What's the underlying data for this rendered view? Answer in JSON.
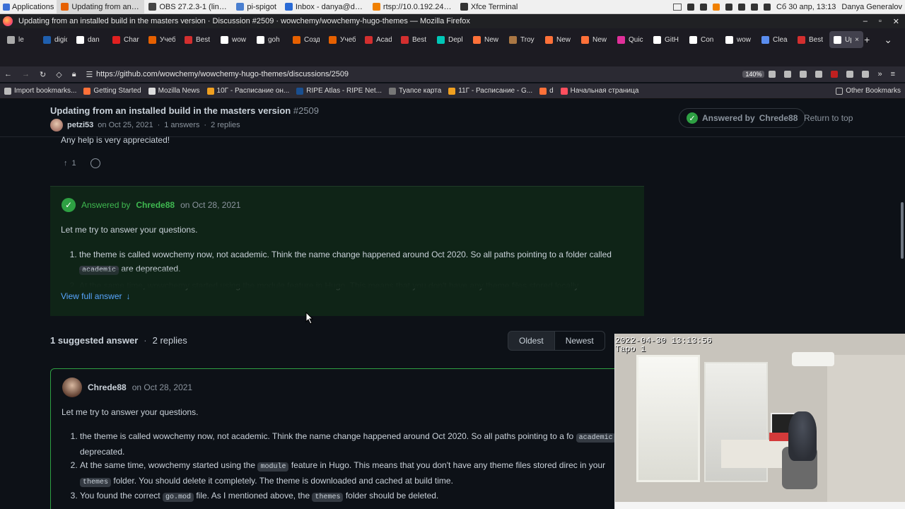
{
  "xfce": {
    "applications_label": "Applications",
    "tasks": [
      {
        "label": "Updating from an in...",
        "color": "#e66000"
      },
      {
        "label": "OBS 27.2.3-1 (linux) -...",
        "color": "#444444"
      },
      {
        "label": "pi-spigot",
        "color": "#4a7fd0"
      },
      {
        "label": "Inbox - danya@dany...",
        "color": "#2a6bd6"
      },
      {
        "label": "rtsp://10.0.192.242/st...",
        "color": "#f08000"
      },
      {
        "label": "Xfce Terminal",
        "color": "#333333"
      }
    ],
    "clock": "Сб 30 апр, 13:13",
    "user": "Danya Generalov"
  },
  "window": {
    "title": "Updating from an installed build in the masters version · Discussion #2509 · wowchemy/wowchemy-hugo-themes — Mozilla Firefox"
  },
  "tabs": [
    {
      "label": "le",
      "color": "#aaaaaa"
    },
    {
      "label": "digicert",
      "color": "#1f5fae"
    },
    {
      "label": "dan",
      "color": "#ffffff"
    },
    {
      "label": "Char",
      "color": "#e02020"
    },
    {
      "label": "Учеб",
      "color": "#e66000"
    },
    {
      "label": "Best",
      "color": "#d32f2f"
    },
    {
      "label": "wow",
      "color": "#ffffff"
    },
    {
      "label": "goh",
      "color": "#ffffff"
    },
    {
      "label": "Созд",
      "color": "#e66000"
    },
    {
      "label": "Учеб",
      "color": "#e66000"
    },
    {
      "label": "Acad",
      "color": "#d32f2f"
    },
    {
      "label": "Best",
      "color": "#d32f2f"
    },
    {
      "label": "Depl",
      "color": "#00c7b7"
    },
    {
      "label": "New",
      "color": "#ff7139"
    },
    {
      "label": "Troy",
      "color": "#aa7744"
    },
    {
      "label": "New",
      "color": "#ff7139"
    },
    {
      "label": "New",
      "color": "#ff7139"
    },
    {
      "label": "Quic",
      "color": "#e0309a"
    },
    {
      "label": "GitH",
      "color": "#ffffff"
    },
    {
      "label": "Con",
      "color": "#ffffff"
    },
    {
      "label": "wow",
      "color": "#ffffff"
    },
    {
      "label": "Clea",
      "color": "#5a8dee"
    },
    {
      "label": "Best",
      "color": "#d32f2f"
    },
    {
      "label": "Up",
      "color": "#ffffff",
      "active": true
    }
  ],
  "nav": {
    "url": "https://github.com/wowchemy/wowchemy-hugo-themes/discussions/2509",
    "zoom": "140%"
  },
  "bookmarks": [
    {
      "label": "Import bookmarks...",
      "color": "#bbbbbb"
    },
    {
      "label": "Getting Started",
      "color": "#ff7139"
    },
    {
      "label": "Mozilla News",
      "color": "#dddddd"
    },
    {
      "label": "10Г - Расписание он...",
      "color": "#f0a020"
    },
    {
      "label": "RIPE Atlas - RIPE Net...",
      "color": "#1a4f8f"
    },
    {
      "label": "Туапсе карта",
      "color": "#777777"
    },
    {
      "label": "11Г - Расписание - G...",
      "color": "#f0a020"
    },
    {
      "label": "d",
      "color": "#ff7139"
    },
    {
      "label": "Начальная страница",
      "color": "#ff4f5e"
    }
  ],
  "bookmarks_other": "Other Bookmarks",
  "discussion": {
    "title": "Updating from an installed build in the masters version",
    "number": "#2509",
    "author": "petzi53",
    "date": "on Oct 25, 2021",
    "answers": "1 answers",
    "replies": "2 replies",
    "answered_by_label": "Answered by",
    "answered_by": "Chrede88",
    "return_to_top": "Return to top",
    "help_text": "Any help is very appreciated!",
    "upvotes": "1"
  },
  "answer": {
    "answered_by_label": "Answered by",
    "author": "Chrede88",
    "date": "on Oct 28, 2021",
    "intro": "Let me try to answer your questions.",
    "item1_pre": "the theme is called wowchemy now, not academic. Think the name change happened around Oct 2020. So all paths pointing to a folder called",
    "item1_code": "academic",
    "item1_post": "are deprecated.",
    "item2_faded": "At the same time, wowchemy started using the module feature in Hugo. This means that you don't have any theme files stored locally",
    "view_full": "View full answer"
  },
  "suggested": {
    "count_label": "1 suggested answer",
    "replies": "2 replies",
    "sort_oldest": "Oldest",
    "sort_newest": "Newest"
  },
  "comment": {
    "author": "Chrede88",
    "date": "on Oct 28, 2021",
    "intro": "Let me try to answer your questions.",
    "item1_pre": "the theme is called wowchemy now, not academic. Think the name change happened around Oct 2020. So all paths pointing to a fo",
    "item1_code": "academic",
    "item1_post": "are deprecated.",
    "item2_pre": "At the same time, wowchemy started using the",
    "item2_code": "module",
    "item2_mid": "feature in Hugo. This means that you don't have any theme files stored direc",
    "item2_line2_pre": "in your",
    "item2_code2": "themes",
    "item2_post": "folder. You should delete it completely. The theme is downloaded and cached at build time.",
    "item3_pre": "You found the correct",
    "item3_code": "go.mod",
    "item3_mid": "file. As I mentioned above, the",
    "item3_code2": "themes",
    "item3_post": "folder should be deleted."
  },
  "camera": {
    "timestamp": "2022-04-30 13:13:56",
    "label": "Тapo 1"
  }
}
